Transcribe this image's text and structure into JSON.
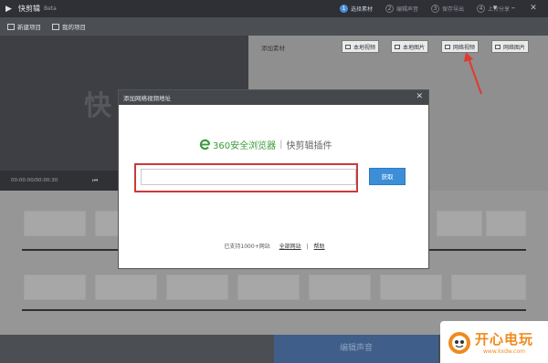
{
  "titlebar": {
    "title": "快剪辑",
    "beta": "Beta",
    "steps": [
      {
        "num": "1",
        "label": "选择素材"
      },
      {
        "num": "2",
        "label": "编辑声音"
      },
      {
        "num": "3",
        "label": "保存导出"
      },
      {
        "num": "4",
        "label": "上传分享"
      }
    ]
  },
  "toolbar": {
    "new_project": "新建项目",
    "my_projects": "我的项目"
  },
  "preview": {
    "watermark": "快",
    "time": "00:00:00/00:00:30"
  },
  "material": {
    "label": "添加素材",
    "buttons": [
      "本地视频",
      "本地图片",
      "网络视频",
      "网络图片"
    ]
  },
  "bottom": {
    "next_label": "编辑声音"
  },
  "dialog": {
    "title": "添加网络视频地址",
    "brand_browser": "360安全浏览器",
    "brand_plugin": "快剪辑插件",
    "url_value": "",
    "fetch_label": "获取",
    "support_text": "已支持1000+网站",
    "all_sites": "全部网站",
    "help": "帮助"
  },
  "colors": {
    "accent_blue": "#3c8fd7",
    "highlight_red": "#c93a3a",
    "brand_green": "#3a9a36",
    "site_orange": "#f08a1d"
  },
  "site_logo": {
    "name": "开心电玩",
    "url": "www.kxdw.com"
  }
}
